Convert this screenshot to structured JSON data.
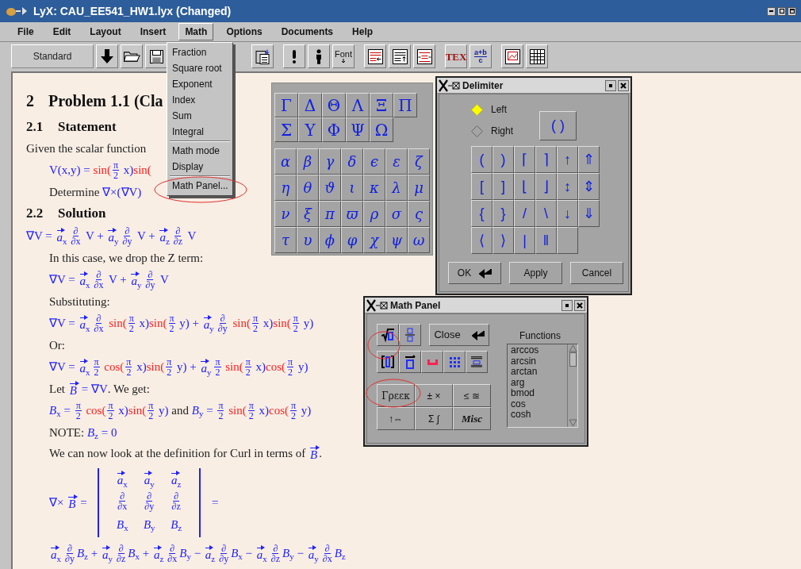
{
  "window": {
    "title": "LyX: CAU_EE541_HW1.lyx (Changed)"
  },
  "menu_bar": [
    {
      "label": "File",
      "selected": false
    },
    {
      "label": "Edit",
      "selected": false
    },
    {
      "label": "Layout",
      "selected": false
    },
    {
      "label": "Insert",
      "selected": false
    },
    {
      "label": "Math",
      "selected": true
    },
    {
      "label": "Options",
      "selected": false
    },
    {
      "label": "Documents",
      "selected": false
    },
    {
      "label": "Help",
      "selected": false
    }
  ],
  "toolbar": {
    "layout": "Standard",
    "buttons": [
      {
        "kind": "down"
      },
      {
        "kind": "open"
      },
      {
        "kind": "save"
      },
      {
        "kind": "paste"
      },
      {
        "kind": "note"
      },
      {
        "kind": "figure"
      },
      {
        "kind": "font",
        "label": "Font"
      },
      {
        "kind": "depth-dec"
      },
      {
        "kind": "depth-inc"
      },
      {
        "kind": "wrap"
      },
      {
        "kind": "tex",
        "label": "TEX"
      },
      {
        "kind": "math",
        "label": "a+b",
        "sublabel": "c"
      },
      {
        "kind": "float"
      },
      {
        "kind": "table"
      }
    ]
  },
  "math_menu": {
    "groups": [
      [
        "Fraction",
        "Square root",
        "Exponent",
        "Index",
        "Sum",
        "Integral"
      ],
      [
        "Math mode",
        "Display"
      ],
      [
        "Math Panel..."
      ]
    ]
  },
  "document": [
    {
      "kind": "section",
      "number": "2",
      "title": "Problem 1.1 (Cla"
    },
    {
      "kind": "subsection",
      "number": "2.1",
      "title": "Statement"
    },
    {
      "kind": "text",
      "indented": false,
      "tokens": [
        {
          "kind": "t",
          "text": "Given the scalar function"
        }
      ]
    },
    {
      "kind": "math",
      "indented": true,
      "tokens": [
        {
          "kind": "m",
          "text": "V(x,y) = "
        },
        {
          "kind": "fn",
          "text": "sin("
        },
        {
          "kind": "frac",
          "num": "π",
          "den": "2"
        },
        {
          "kind": "m",
          "text": " x)"
        },
        {
          "kind": "fn",
          "text": "sin("
        }
      ]
    },
    {
      "kind": "text",
      "indented": true,
      "tokens": [
        {
          "kind": "t",
          "text": "Determine "
        },
        {
          "kind": "m",
          "text": "∇×(∇V)"
        }
      ]
    },
    {
      "kind": "subsection",
      "number": "2.2",
      "title": "Solution"
    },
    {
      "kind": "math",
      "indented": false,
      "tokens": [
        {
          "kind": "m",
          "text": "∇V = "
        },
        {
          "kind": "vec",
          "base": "a",
          "sub": "x"
        },
        {
          "kind": "frac",
          "num": "∂",
          "den": "∂x"
        },
        {
          "kind": "m",
          "text": " V + "
        },
        {
          "kind": "vec",
          "base": "a",
          "sub": "y"
        },
        {
          "kind": "frac",
          "num": "∂",
          "den": "∂y"
        },
        {
          "kind": "m",
          "text": " V + "
        },
        {
          "kind": "vec",
          "base": "a",
          "sub": "z"
        },
        {
          "kind": "frac",
          "num": "∂",
          "den": "∂z"
        },
        {
          "kind": "m",
          "text": " V"
        }
      ]
    },
    {
      "kind": "text",
      "indented": true,
      "tokens": [
        {
          "kind": "t",
          "text": "In this case, we drop the Z term:"
        }
      ]
    },
    {
      "kind": "math",
      "indented": true,
      "tokens": [
        {
          "kind": "m",
          "text": "∇V = "
        },
        {
          "kind": "vec",
          "base": "a",
          "sub": "x"
        },
        {
          "kind": "frac",
          "num": "∂",
          "den": "∂x"
        },
        {
          "kind": "m",
          "text": " V + "
        },
        {
          "kind": "vec",
          "base": "a",
          "sub": "y"
        },
        {
          "kind": "frac",
          "num": "∂",
          "den": "∂y"
        },
        {
          "kind": "m",
          "text": " V"
        }
      ]
    },
    {
      "kind": "text",
      "indented": true,
      "tokens": [
        {
          "kind": "t",
          "text": "Substituting:"
        }
      ]
    },
    {
      "kind": "math",
      "indented": true,
      "tokens": [
        {
          "kind": "m",
          "text": "∇V = "
        },
        {
          "kind": "vec",
          "base": "a",
          "sub": "x"
        },
        {
          "kind": "frac",
          "num": "∂",
          "den": "∂x"
        },
        {
          "kind": "fn",
          "text": " sin("
        },
        {
          "kind": "frac",
          "num": "π",
          "den": "2"
        },
        {
          "kind": "m",
          "text": " x)"
        },
        {
          "kind": "fn",
          "text": "sin("
        },
        {
          "kind": "frac",
          "num": "π",
          "den": "2"
        },
        {
          "kind": "m",
          "text": " y) + "
        },
        {
          "kind": "vec",
          "base": "a",
          "sub": "y"
        },
        {
          "kind": "frac",
          "num": "∂",
          "den": "∂y"
        },
        {
          "kind": "fn",
          "text": " sin("
        },
        {
          "kind": "frac",
          "num": "π",
          "den": "2"
        },
        {
          "kind": "m",
          "text": " x)"
        },
        {
          "kind": "fn",
          "text": "sin("
        },
        {
          "kind": "frac",
          "num": "π",
          "den": "2"
        },
        {
          "kind": "m",
          "text": " y)"
        }
      ]
    },
    {
      "kind": "text",
      "indented": true,
      "tokens": [
        {
          "kind": "t",
          "text": "Or:"
        }
      ]
    },
    {
      "kind": "math",
      "indented": true,
      "tokens": [
        {
          "kind": "m",
          "text": "∇V = "
        },
        {
          "kind": "vec",
          "base": "a",
          "sub": "x"
        },
        {
          "kind": "frac",
          "num": "π",
          "den": "2"
        },
        {
          "kind": "fn",
          "text": " cos("
        },
        {
          "kind": "frac",
          "num": "π",
          "den": "2"
        },
        {
          "kind": "m",
          "text": " x)"
        },
        {
          "kind": "fn",
          "text": "sin("
        },
        {
          "kind": "frac",
          "num": "π",
          "den": "2"
        },
        {
          "kind": "m",
          "text": " y) + "
        },
        {
          "kind": "vec",
          "base": "a",
          "sub": "y"
        },
        {
          "kind": "frac",
          "num": "π",
          "den": "2"
        },
        {
          "kind": "fn",
          "text": " sin("
        },
        {
          "kind": "frac",
          "num": "π",
          "den": "2"
        },
        {
          "kind": "m",
          "text": " x)"
        },
        {
          "kind": "fn",
          "text": "cos("
        },
        {
          "kind": "frac",
          "num": "π",
          "den": "2"
        },
        {
          "kind": "m",
          "text": " y)"
        }
      ]
    },
    {
      "kind": "text",
      "indented": true,
      "tokens": [
        {
          "kind": "t",
          "text": "Let "
        },
        {
          "kind": "vec",
          "base": "B"
        },
        {
          "kind": "m",
          "text": " = ∇V"
        },
        {
          "kind": "t",
          "text": ". We get:"
        }
      ]
    },
    {
      "kind": "math",
      "indented": true,
      "tokens": [
        {
          "kind": "sub",
          "base": "B",
          "sub": "x"
        },
        {
          "kind": "m",
          "text": " = "
        },
        {
          "kind": "frac",
          "num": "π",
          "den": "2"
        },
        {
          "kind": "fn",
          "text": " cos("
        },
        {
          "kind": "frac",
          "num": "π",
          "den": "2"
        },
        {
          "kind": "m",
          "text": " x)"
        },
        {
          "kind": "fn",
          "text": "sin("
        },
        {
          "kind": "frac",
          "num": "π",
          "den": "2"
        },
        {
          "kind": "m",
          "text": " y)"
        },
        {
          "kind": "t",
          "text": " and "
        },
        {
          "kind": "sub",
          "base": "B",
          "sub": "y"
        },
        {
          "kind": "m",
          "text": " = "
        },
        {
          "kind": "frac",
          "num": "π",
          "den": "2"
        },
        {
          "kind": "fn",
          "text": " sin("
        },
        {
          "kind": "frac",
          "num": "π",
          "den": "2"
        },
        {
          "kind": "m",
          "text": " x)"
        },
        {
          "kind": "fn",
          "text": "cos("
        },
        {
          "kind": "frac",
          "num": "π",
          "den": "2"
        },
        {
          "kind": "m",
          "text": " y)"
        }
      ]
    },
    {
      "kind": "text",
      "indented": true,
      "tokens": [
        {
          "kind": "t",
          "text": "NOTE: "
        },
        {
          "kind": "sub",
          "base": "B",
          "sub": "z"
        },
        {
          "kind": "m",
          "text": " = 0"
        }
      ]
    },
    {
      "kind": "text",
      "indented": true,
      "tokens": [
        {
          "kind": "t",
          "text": "We can now look at the definition for Curl in terms of "
        },
        {
          "kind": "vec",
          "base": "B"
        },
        {
          "kind": "t",
          "text": "."
        }
      ]
    },
    {
      "kind": "math",
      "indented": true,
      "tokens": [
        {
          "kind": "m",
          "text": "∇× "
        },
        {
          "kind": "vec",
          "base": "B"
        },
        {
          "kind": "m",
          "text": " = "
        },
        {
          "kind": "matrix",
          "rows": [
            [
              {
                "kind": "vec",
                "base": "a",
                "sub": "x"
              },
              {
                "kind": "vec",
                "base": "a",
                "sub": "y"
              },
              {
                "kind": "vec",
                "base": "a",
                "sub": "z"
              }
            ],
            [
              {
                "kind": "frac",
                "num": "∂",
                "den": "∂x"
              },
              {
                "kind": "frac",
                "num": "∂",
                "den": "∂y"
              },
              {
                "kind": "frac",
                "num": "∂",
                "den": "∂z"
              }
            ],
            [
              {
                "kind": "sub",
                "base": "B",
                "sub": "x"
              },
              {
                "kind": "sub",
                "base": "B",
                "sub": "y"
              },
              {
                "kind": "sub",
                "base": "B",
                "sub": "z"
              }
            ]
          ]
        },
        {
          "kind": "m",
          "text": " ="
        }
      ]
    },
    {
      "kind": "math",
      "indented": true,
      "tokens": [
        {
          "kind": "vec",
          "base": "a",
          "sub": "x"
        },
        {
          "kind": "frac",
          "num": "∂",
          "den": "∂y"
        },
        {
          "kind": "sub",
          "base": "B",
          "sub": "z"
        },
        {
          "kind": "m",
          "text": " + "
        },
        {
          "kind": "vec",
          "base": "a",
          "sub": "y"
        },
        {
          "kind": "frac",
          "num": "∂",
          "den": "∂z"
        },
        {
          "kind": "sub",
          "base": "B",
          "sub": "x"
        },
        {
          "kind": "m",
          "text": " + "
        },
        {
          "kind": "vec",
          "base": "a",
          "sub": "z"
        },
        {
          "kind": "frac",
          "num": "∂",
          "den": "∂x"
        },
        {
          "kind": "sub",
          "base": "B",
          "sub": "y"
        },
        {
          "kind": "m",
          "text": " − "
        },
        {
          "kind": "vec",
          "base": "a",
          "sub": "z"
        },
        {
          "kind": "frac",
          "num": "∂",
          "den": "∂y"
        },
        {
          "kind": "sub",
          "base": "B",
          "sub": "x"
        },
        {
          "kind": "m",
          "text": " − "
        },
        {
          "kind": "vec",
          "base": "a",
          "sub": "x"
        },
        {
          "kind": "frac",
          "num": "∂",
          "den": "∂z"
        },
        {
          "kind": "sub",
          "base": "B",
          "sub": "y"
        },
        {
          "kind": "m",
          "text": " − "
        },
        {
          "kind": "vec",
          "base": "a",
          "sub": "y"
        },
        {
          "kind": "frac",
          "num": "∂",
          "den": "∂x"
        },
        {
          "kind": "sub",
          "base": "B",
          "sub": "z"
        }
      ]
    }
  ],
  "greek_panel": {
    "upper": [
      "Γ",
      "Δ",
      "Θ",
      "Λ",
      "Ξ",
      "Π",
      "Σ",
      "Υ",
      "Φ",
      "Ψ",
      "Ω"
    ],
    "lower": [
      "α",
      "β",
      "γ",
      "δ",
      "ϵ",
      "ε",
      "ζ",
      "η",
      "θ",
      "ϑ",
      "ι",
      "κ",
      "λ",
      "μ",
      "ν",
      "ξ",
      "π",
      "ϖ",
      "ρ",
      "σ",
      "ς",
      "τ",
      "υ",
      "ϕ",
      "φ",
      "χ",
      "ψ",
      "ω"
    ]
  },
  "delimiter": {
    "title": "Delimiter",
    "sides": [
      {
        "label": "Left",
        "selected": true
      },
      {
        "label": "Right",
        "selected": false
      }
    ],
    "preview": "( )",
    "symbols": [
      "(",
      ")",
      "⌈",
      "⌉",
      "↑",
      "⇑",
      "[",
      "]",
      "⌊",
      "⌋",
      "↕",
      "⇕",
      "{",
      "}",
      "/",
      "\\",
      "↓",
      "⇓",
      "⟨",
      "⟩",
      "|",
      "‖"
    ],
    "buttons": [
      "OK",
      "Apply",
      "Cancel"
    ]
  },
  "math_panel": {
    "title": "Math Panel",
    "close": "Close",
    "symbol_buttons": [
      {
        "kind": "greek",
        "label": "Γρεεκ"
      },
      {
        "kind": "plain",
        "label": "± ×"
      },
      {
        "kind": "plain",
        "label": "≤ ≊"
      },
      {
        "kind": "plain",
        "label": "↑⇔"
      },
      {
        "kind": "plain",
        "label": "Σ ∫"
      },
      {
        "kind": "misc",
        "label": "Misc"
      }
    ],
    "functions_label": "Functions",
    "functions": [
      "arccos",
      "arcsin",
      "arctan",
      "arg",
      "bmod",
      "cos",
      "cosh"
    ]
  }
}
